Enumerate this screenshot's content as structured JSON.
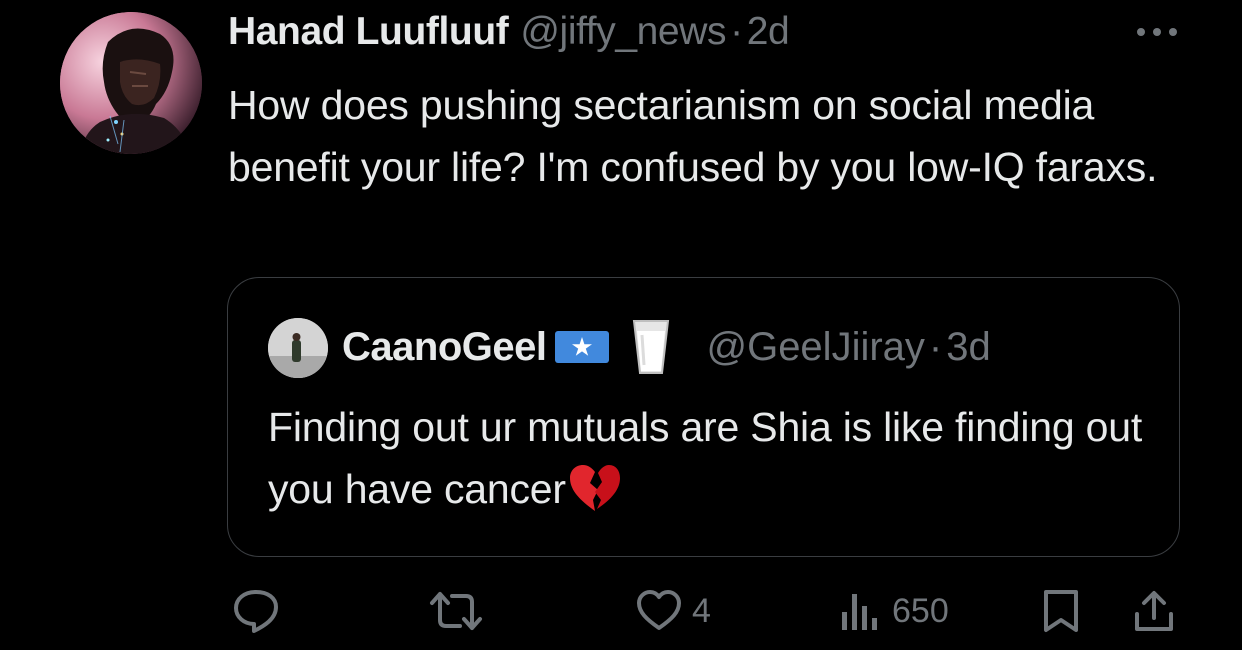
{
  "tweet": {
    "author_name": "Hanad Luufluuf",
    "author_handle": "@jiffy_news",
    "separator": "·",
    "age": "2d",
    "text": "How does pushing sectarianism on social media benefit your life? I'm confused by you low-IQ faraxs.",
    "more_icon": "more-dots-icon"
  },
  "quoted_tweet": {
    "author_name": "CaanoGeel",
    "name_emojis": [
      "somalia-flag-icon",
      "milk-glass-icon"
    ],
    "author_handle": "@GeelJiiray",
    "separator": "·",
    "age": "3d",
    "text": "Finding out ur mutuals are Shia is like finding out you have cancer",
    "trailing_emoji": "broken-heart-icon"
  },
  "actions": {
    "reply": {
      "icon": "reply-icon",
      "count": ""
    },
    "retweet": {
      "icon": "retweet-icon",
      "count": ""
    },
    "like": {
      "icon": "heart-icon",
      "count": "4"
    },
    "views": {
      "icon": "views-chart-icon",
      "count": "650"
    },
    "bookmark": {
      "icon": "bookmark-icon"
    },
    "share": {
      "icon": "share-icon"
    }
  },
  "colors": {
    "background": "#000000",
    "primary_text": "#e7e9ea",
    "secondary_text": "#71767b",
    "border": "#3a3d41",
    "flag_blue": "#4189dd"
  }
}
